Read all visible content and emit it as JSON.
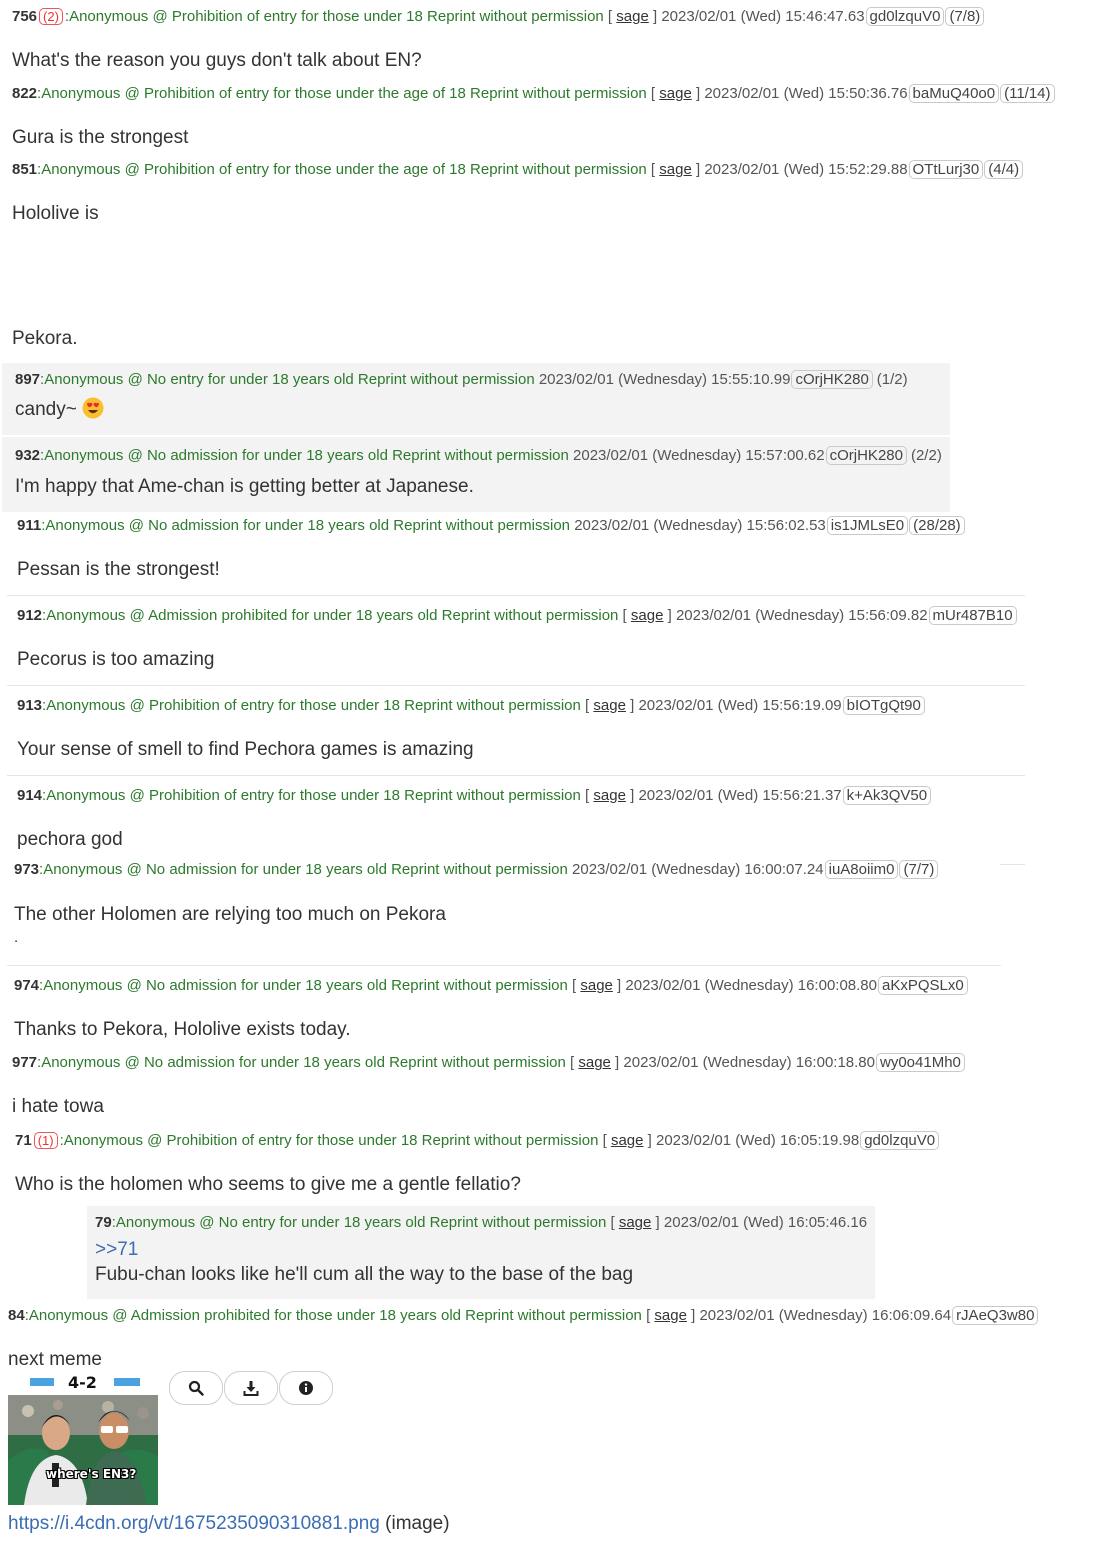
{
  "posts": [
    {
      "num": "756",
      "refs": "(2)",
      "name": ":Anonymous @ Prohibition of entry for those under 18 Reprint without permission",
      "sage": "sage",
      "date": "2023/02/01 (Wed) 15:46:47.63",
      "id": "gd0lzquV0",
      "count": "(7/8)",
      "body": "What's the reason you guys don't talk about EN?"
    },
    {
      "num": "822",
      "name": ":Anonymous @ Prohibition of entry for those under the age of 18 Reprint without permission",
      "sage": "sage",
      "date": "2023/02/01 (Wed) 15:50:36.76",
      "id": "baMuQ40o0",
      "count": "(11/14)",
      "body": "Gura is the strongest"
    },
    {
      "num": "851",
      "name": ":Anonymous @ Prohibition of entry for those under the age of 18 Reprint without permission",
      "sage": "sage",
      "date": "2023/02/01 (Wed) 15:52:29.88",
      "id": "OTtLurj30",
      "count": "(4/4)",
      "body": "Hololive is",
      "body2": "Pekora."
    },
    {
      "num": "897",
      "name": ":Anonymous @ No entry for under 18 years old Reprint without permission",
      "date": "2023/02/01 (Wednesday) 15:55:10.99",
      "id": "cOrjHK280",
      "count": "(1/2)",
      "body": "candy~"
    },
    {
      "num": "932",
      "name": ":Anonymous @ No admission for under 18 years old Reprint without permission",
      "date": "2023/02/01 (Wednesday) 15:57:00.62",
      "id": "cOrjHK280",
      "count": "(2/2)",
      "body": "I'm happy that Ame-chan is getting better at Japanese."
    },
    {
      "num": "911",
      "name": ":Anonymous @ No admission for under 18 years old Reprint without permission",
      "date": "2023/02/01 (Wednesday) 15:56:02.53",
      "id": "is1JMLsE0",
      "count": "(28/28)",
      "body": "Pessan is the strongest!"
    },
    {
      "num": "912",
      "name": ":Anonymous @ Admission prohibited for under 18 years old Reprint without permission",
      "sage": "sage",
      "date": "2023/02/01 (Wednesday) 15:56:09.82",
      "id": "mUr487B10",
      "body": "Pecorus is too amazing"
    },
    {
      "num": "913",
      "name": ":Anonymous @ Prohibition of entry for those under 18 Reprint without permission",
      "sage": "sage",
      "date": "2023/02/01 (Wed) 15:56:19.09",
      "id": "bIOTgQt90",
      "body": "Your sense of smell to find Pechora games is amazing"
    },
    {
      "num": "914",
      "name": ":Anonymous @ Prohibition of entry for those under 18 Reprint without permission",
      "sage": "sage",
      "date": "2023/02/01 (Wed) 15:56:21.37",
      "id": "k+Ak3QV50",
      "body": "pechora god"
    },
    {
      "num": "973",
      "name": ":Anonymous @ No admission for under 18 years old Reprint without permission",
      "date": "2023/02/01 (Wednesday) 16:00:07.24",
      "id": "iuA8oiim0",
      "count": "(7/7)",
      "body": "The other Holomen are relying too much on Pekora",
      "body2": "."
    },
    {
      "num": "974",
      "name": ":Anonymous @ No admission for under 18 years old Reprint without permission",
      "sage": "sage",
      "date": "2023/02/01 (Wednesday) 16:00:08.80",
      "id": "aKxPQSLx0",
      "body": "Thanks to Pekora, Hololive exists today."
    },
    {
      "num": "977",
      "name": ":Anonymous @ No admission for under 18 years old Reprint without permission",
      "sage": "sage",
      "date": "2023/02/01 (Wednesday) 16:00:18.80",
      "id": "wy0o41Mh0",
      "body": "i hate towa"
    },
    {
      "num": "71",
      "refs": "(1)",
      "name": ":Anonymous @ Prohibition of entry for those under 18 Reprint without permission",
      "sage": "sage",
      "date": "2023/02/01 (Wed) 16:05:19.98",
      "id": "gd0lzquV0",
      "body": "Who is the holomen who seems to give me a gentle fellatio?"
    },
    {
      "num": "79",
      "name": ":Anonymous @ No entry for under 18 years old Reprint without permission",
      "sage": "sage",
      "date": "2023/02/01 (Wed) 16:05:46.16",
      "quote": ">>71",
      "body": "Fubu-chan looks like he'll cum all the way to the base of the bag"
    },
    {
      "num": "84",
      "name": ":Anonymous @ Admission prohibited for those under 18 years old Reprint without permission",
      "sage": "sage",
      "date": "2023/02/01 (Wednesday) 16:06:09.64",
      "id": "rJAeQ3w80",
      "body": "next meme"
    }
  ],
  "image": {
    "score": "4-2",
    "caption": "where's EN3?",
    "url": "https://i.4cdn.org/vt/1675235090310881.png",
    "suffix": "(image)"
  },
  "toolbar": [
    "search-icon",
    "download-icon",
    "info-icon"
  ],
  "colors": {
    "name_green": "#2c7a2c",
    "ref_red": "#e33333",
    "link_blue": "#3b6db3",
    "panel_gray": "#f3f3f3"
  }
}
